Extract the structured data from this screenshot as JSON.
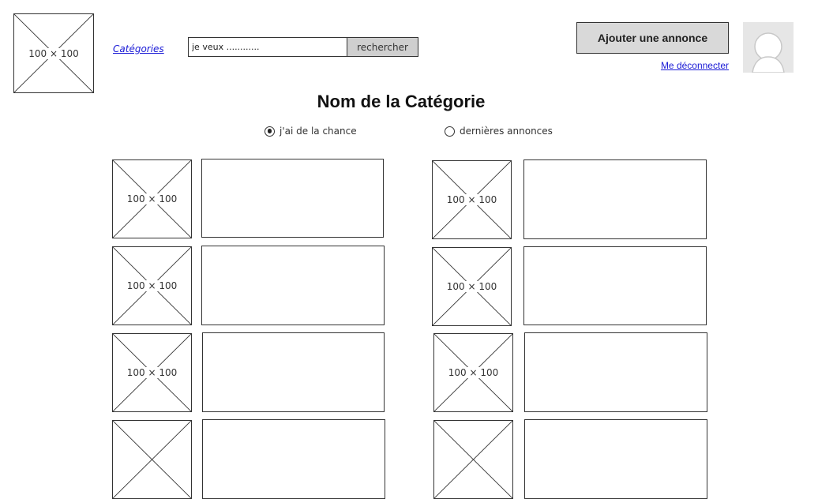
{
  "header": {
    "logo_placeholder": "100 × 100",
    "categories_link": "Catégories",
    "search": {
      "value": "je veux ............",
      "button_label": "rechercher"
    },
    "add_listing_button": "Ajouter une annonce",
    "logout_link": "Me déconnecter"
  },
  "main": {
    "title": "Nom de la Catégorie",
    "sort_options": [
      {
        "label": "j'ai de la chance",
        "selected": true
      },
      {
        "label": "dernières annonces",
        "selected": false
      }
    ],
    "listing_placeholder": "100 × 100"
  },
  "colors": {
    "link": "#1a1ad6",
    "button_bg": "#d9d9d9",
    "search_button_bg": "#cfcfcf",
    "avatar_bg": "#e6e6e6"
  }
}
